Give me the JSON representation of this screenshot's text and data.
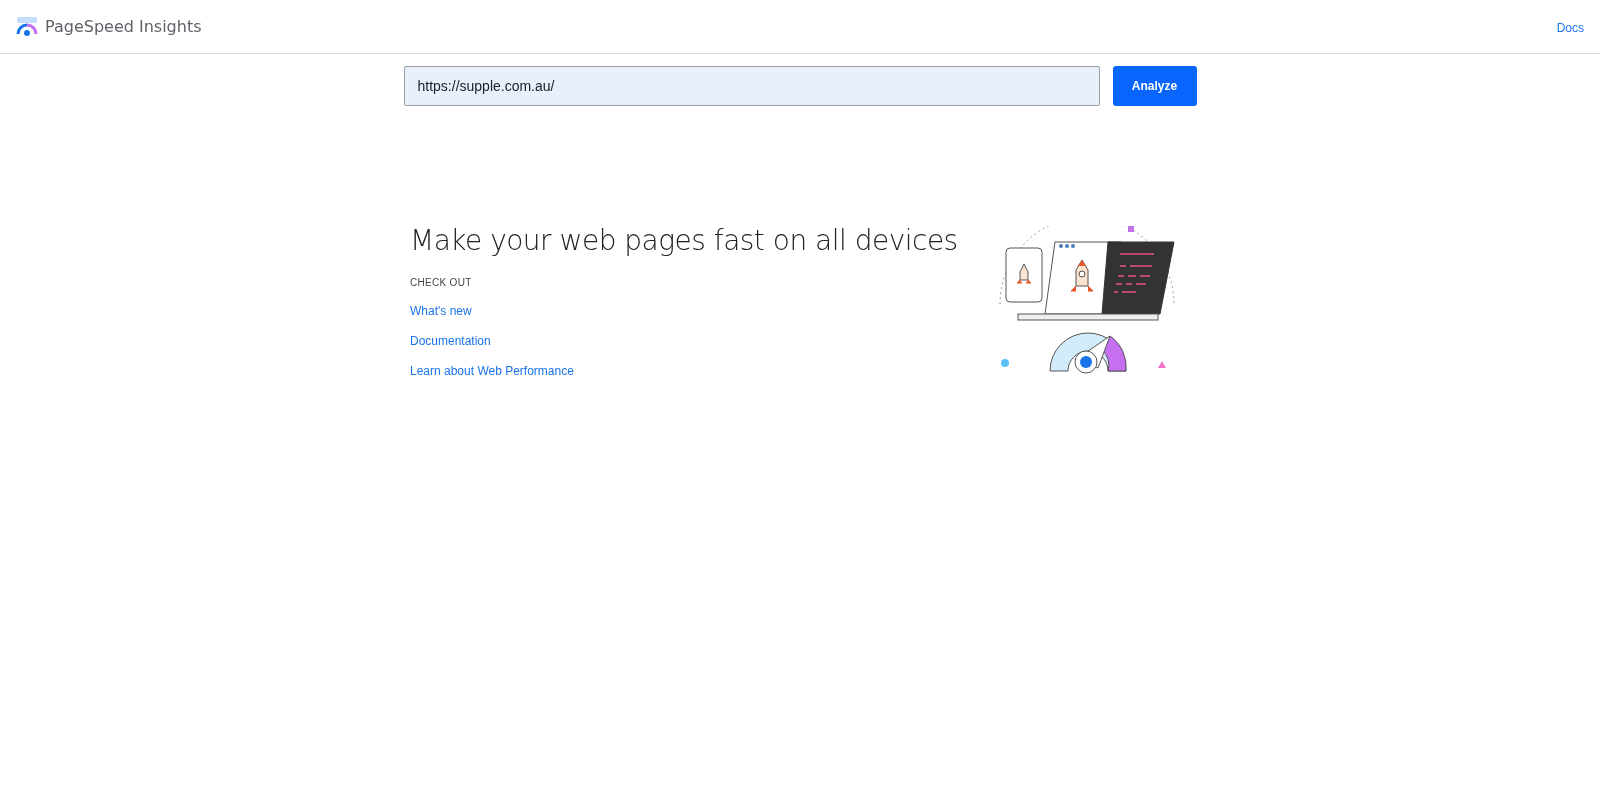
{
  "header": {
    "title": "PageSpeed Insights",
    "links": [
      "Docs"
    ]
  },
  "search": {
    "value": "https://supple.com.au/",
    "button": "Analyze"
  },
  "intro": {
    "heading": "Make your web pages fast on all devices",
    "section_label": "CHECK OUT",
    "links": [
      "What's new",
      "Documentation",
      "Learn about Web Performance"
    ]
  }
}
